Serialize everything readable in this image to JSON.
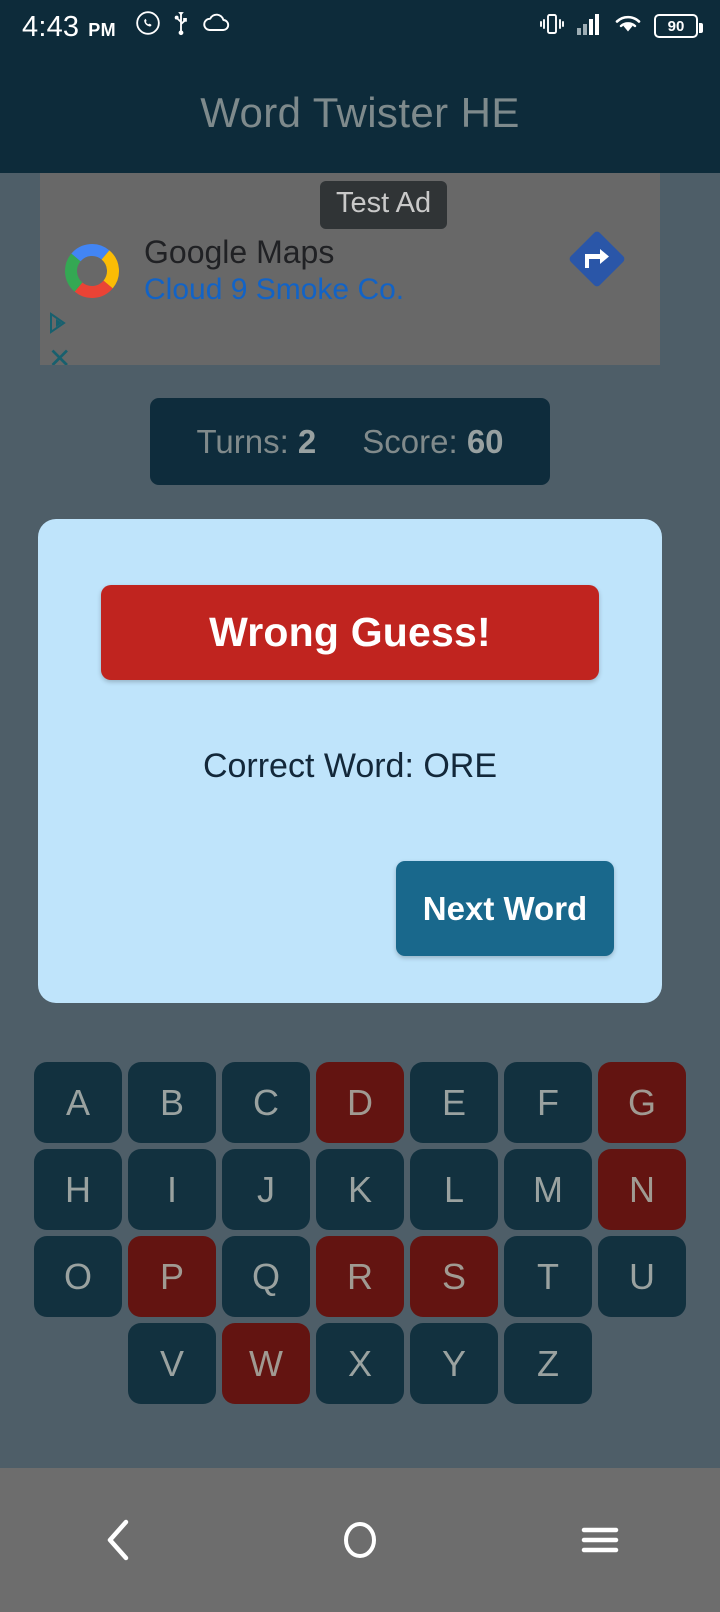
{
  "status_bar": {
    "time": "4:43",
    "ampm": "PM",
    "icons": [
      "whatsapp-icon",
      "usb-icon",
      "cloud-icon",
      "vibrate-icon",
      "signal-icon",
      "wifi-icon"
    ],
    "battery_level": "90"
  },
  "app_bar": {
    "title": "Word Twister HE"
  },
  "ad": {
    "badge": "Test Ad",
    "headline": "Google Maps",
    "subtitle": "Cloud 9 Smoke Co.",
    "advertiser_icon": "google-maps-logo-icon",
    "cta_icon": "navigation-arrow-icon",
    "adchoices_icon": "adchoices-icon",
    "close_icon": "ad-close-icon"
  },
  "score_bar": {
    "turns_label": "Turns:",
    "turns_value": "2",
    "score_label": "Score:",
    "score_value": "60"
  },
  "dialog": {
    "result_banner": "Wrong Guess!",
    "correct_word_text": "Correct Word: ORE",
    "next_button": "Next Word"
  },
  "keyboard": {
    "rows": [
      [
        {
          "letter": "A",
          "used": false
        },
        {
          "letter": "B",
          "used": false
        },
        {
          "letter": "C",
          "used": false
        },
        {
          "letter": "D",
          "used": true
        },
        {
          "letter": "E",
          "used": false
        },
        {
          "letter": "F",
          "used": false
        },
        {
          "letter": "G",
          "used": true
        }
      ],
      [
        {
          "letter": "H",
          "used": false
        },
        {
          "letter": "I",
          "used": false
        },
        {
          "letter": "J",
          "used": false
        },
        {
          "letter": "K",
          "used": false
        },
        {
          "letter": "L",
          "used": false
        },
        {
          "letter": "M",
          "used": false
        },
        {
          "letter": "N",
          "used": true
        }
      ],
      [
        {
          "letter": "O",
          "used": false
        },
        {
          "letter": "P",
          "used": true
        },
        {
          "letter": "Q",
          "used": false
        },
        {
          "letter": "R",
          "used": true
        },
        {
          "letter": "S",
          "used": true
        },
        {
          "letter": "T",
          "used": false
        },
        {
          "letter": "U",
          "used": false
        }
      ],
      [
        {
          "letter": "V",
          "used": false
        },
        {
          "letter": "W",
          "used": true
        },
        {
          "letter": "X",
          "used": false
        },
        {
          "letter": "Y",
          "used": false
        },
        {
          "letter": "Z",
          "used": false
        }
      ]
    ]
  },
  "nav_bar": {
    "back_icon": "back-chevron-icon",
    "home_icon": "home-circle-icon",
    "recents_icon": "menu-hamburger-icon"
  },
  "colors": {
    "app_bar": "#0d2b3a",
    "scrim": "#4e5e68",
    "dialog_bg": "#bfe4fb",
    "wrong_red": "#c0241f",
    "next_teal": "#19688c",
    "key_navy": "#12313f",
    "key_used_red": "#631411",
    "ad_link_blue": "#1263c6"
  }
}
